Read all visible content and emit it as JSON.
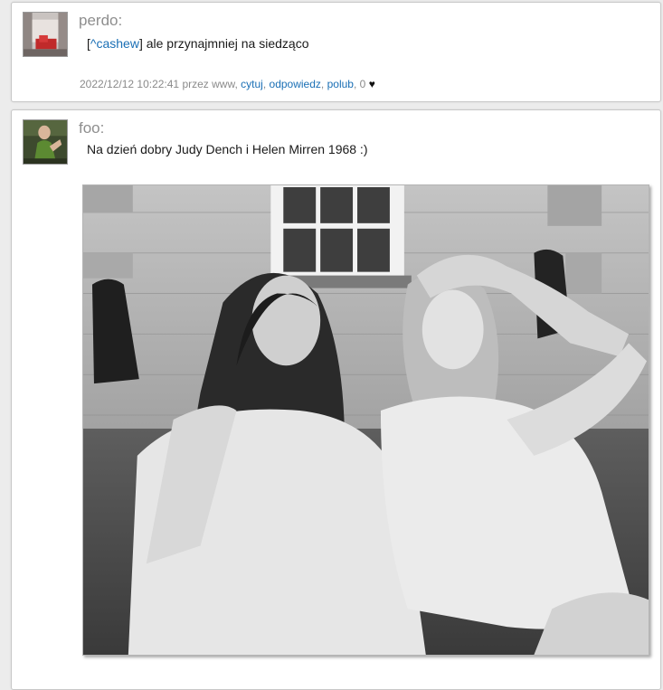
{
  "posts": [
    {
      "username": "perdo:",
      "reply_to_open": "[",
      "reply_to": "^cashew",
      "reply_to_close": "]",
      "text": " ale przynajmniej na siedząco",
      "timestamp": "2022/12/12 10:22:41",
      "by_label": "przez",
      "author": "www,",
      "actions": {
        "quote": "cytuj",
        "reply": "odpowiedz",
        "like": "polub"
      },
      "sep": ",",
      "likes": "0",
      "heart_icon": "heart-icon"
    },
    {
      "username": "foo:",
      "text": "Na dzień dobry Judy Dench i Helen Mirren 1968 :)",
      "image": "black-and-white photo of two young women sitting on grass"
    }
  ],
  "colors": {
    "link": "#1a6fb5",
    "username": "#8e8e8e",
    "meta": "#8a8a8a",
    "page_bg": "#ececec"
  }
}
